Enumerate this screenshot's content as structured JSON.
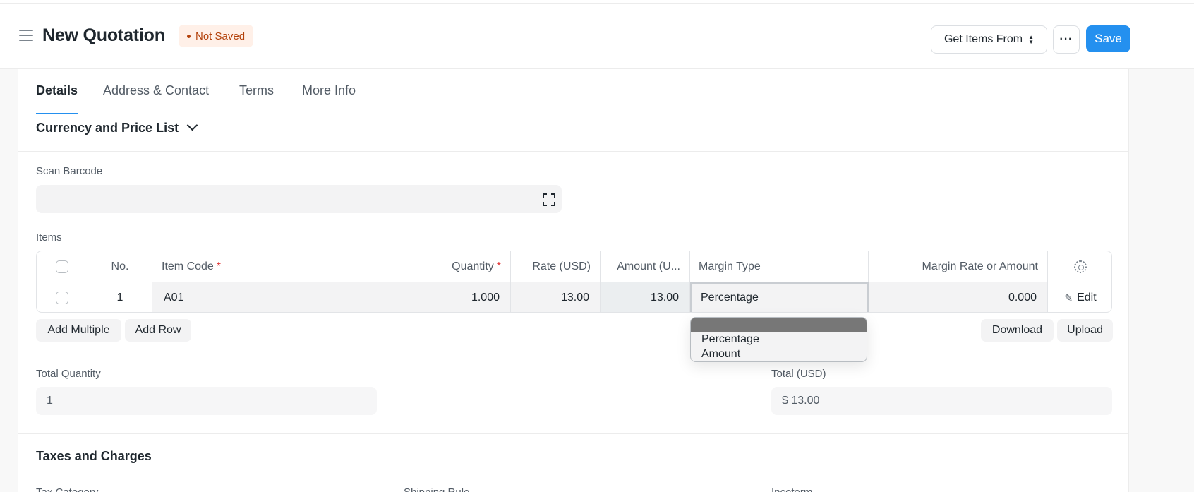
{
  "header": {
    "title": "New Quotation",
    "status": "Not Saved",
    "get_items_label": "Get Items From",
    "more_label": "···",
    "save_label": "Save"
  },
  "tabs": [
    {
      "label": "Details",
      "active": true
    },
    {
      "label": "Address & Contact",
      "active": false
    },
    {
      "label": "Terms",
      "active": false
    },
    {
      "label": "More Info",
      "active": false
    }
  ],
  "currency_section": {
    "title": "Currency and Price List"
  },
  "scan_barcode": {
    "label": "Scan Barcode",
    "value": ""
  },
  "items": {
    "label": "Items",
    "columns": [
      "No.",
      "Item Code",
      "Quantity",
      "Rate (USD)",
      "Amount (U...",
      "Margin Type",
      "Margin Rate or Amount"
    ],
    "rows": [
      {
        "no": "1",
        "item_code": "A01",
        "quantity": "1.000",
        "rate": "13.00",
        "amount": "13.00",
        "margin_type": "Percentage",
        "margin_rate": "0.000",
        "edit_label": "Edit"
      }
    ],
    "add_multiple_label": "Add Multiple",
    "add_row_label": "Add Row",
    "download_label": "Download",
    "upload_label": "Upload"
  },
  "margin_type_dropdown": {
    "options": [
      "Percentage",
      "Amount"
    ]
  },
  "totals": {
    "total_quantity_label": "Total Quantity",
    "total_quantity_value": "1",
    "total_label": "Total (USD)",
    "total_value": "$ 13.00"
  },
  "taxes_section": {
    "title": "Taxes and Charges",
    "tax_category_label": "Tax Category",
    "shipping_rule_label": "Shipping Rule",
    "incoterm_label": "Incoterm"
  },
  "colors": {
    "primary": "#2490ef",
    "status_bg": "#fff0e8",
    "status_text": "#b4420b"
  }
}
